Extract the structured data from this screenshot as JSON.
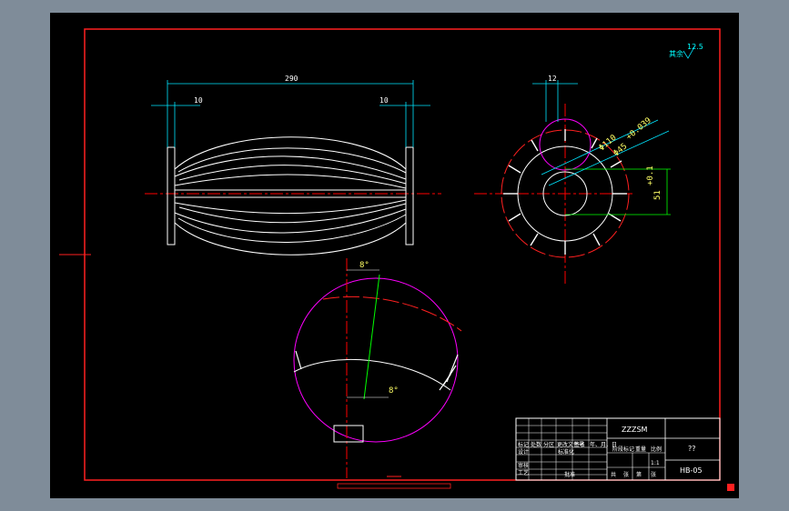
{
  "drawing": {
    "dims": {
      "overall_length": "290",
      "left_end": "10",
      "right_end": "10",
      "flange_width": "12",
      "dia_outer": "Φ110",
      "dia_bore": "Φ45",
      "bore_tol": "+0.039",
      "key_depth": "51",
      "key_tol": "+0.1",
      "helix_top": "8°",
      "helix_bottom": "8°"
    },
    "roughness": {
      "label": "其余",
      "value": "12.5"
    },
    "title_block": {
      "part_code": "ZZZSM",
      "unit_note": "??",
      "drawing_number": "HB-05",
      "col_headers": [
        "标记",
        "处数",
        "分区",
        "更改文件号",
        "签名",
        "年、月、日"
      ],
      "row_labels": [
        "设计",
        "审核",
        "工艺"
      ],
      "std_label": "标准化",
      "approve_label": "批准",
      "stage_label": "阶段标记",
      "weight_label": "重量",
      "scale_label": "比例",
      "sheet_labels": [
        "共",
        "张",
        "第",
        "张"
      ],
      "scale_value": "1:1"
    }
  },
  "colors": {
    "frame_red": "#ff2020",
    "dim_cyan": "#00e5ff",
    "centerline_red": "#ff0000",
    "magenta": "#ff00ff",
    "green": "#00ff00",
    "white": "#ffffff",
    "yellow": "#ffff66"
  }
}
